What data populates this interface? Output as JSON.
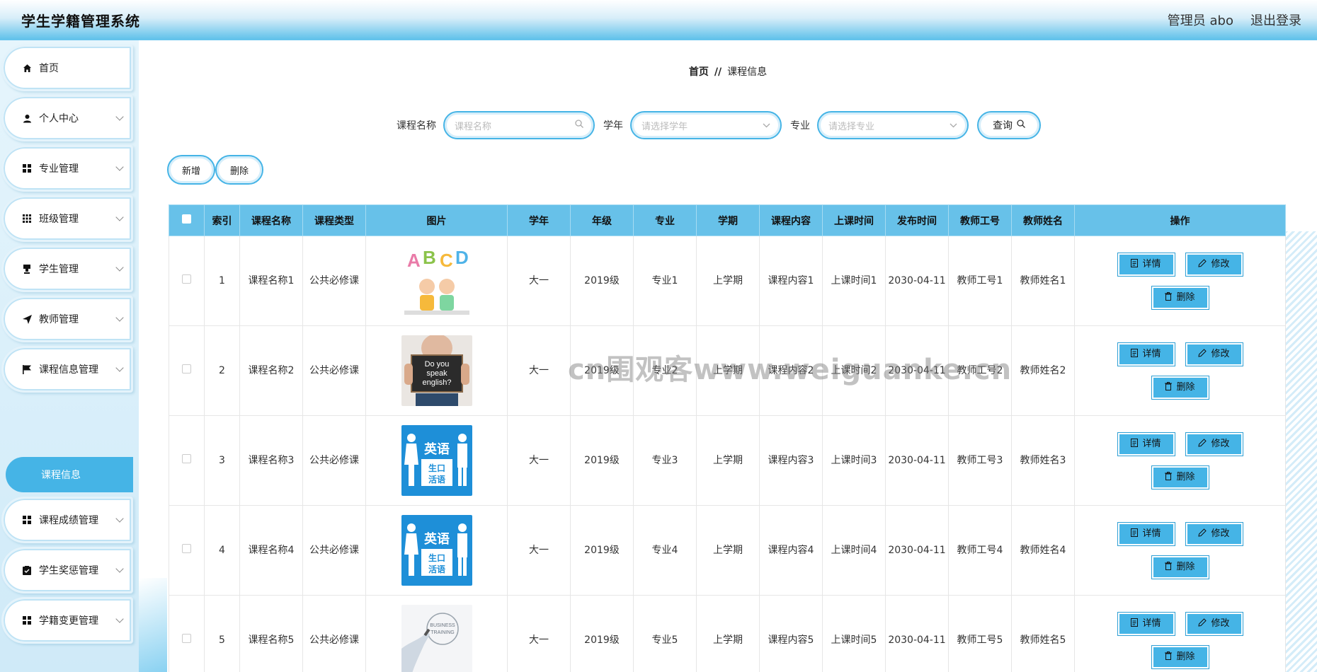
{
  "header": {
    "title": "学生学籍管理系统",
    "user": "管理员 abo",
    "logout": "退出登录"
  },
  "sidebar": {
    "items": [
      {
        "label": "首页",
        "icon": "home-icon"
      },
      {
        "label": "个人中心",
        "icon": "user-icon"
      },
      {
        "label": "专业管理",
        "icon": "grid-icon"
      },
      {
        "label": "班级管理",
        "icon": "grid-dots-icon"
      },
      {
        "label": "学生管理",
        "icon": "stamp-icon"
      },
      {
        "label": "教师管理",
        "icon": "send-icon"
      },
      {
        "label": "课程信息管理",
        "icon": "flag-icon"
      },
      {
        "label": "课程成绩管理",
        "icon": "grid-icon"
      },
      {
        "label": "学生奖惩管理",
        "icon": "clipboard-icon"
      },
      {
        "label": "学籍变更管理",
        "icon": "grid-icon"
      }
    ],
    "active_sub": "课程信息"
  },
  "breadcrumb": {
    "home": "首页",
    "sep": "//",
    "current": "课程信息"
  },
  "search": {
    "course_label": "课程名称",
    "course_placeholder": "课程名称",
    "year_label": "学年",
    "year_placeholder": "请选择学年",
    "major_label": "专业",
    "major_placeholder": "请选择专业",
    "query_label": "查询"
  },
  "actions": {
    "add": "新增",
    "delete": "删除"
  },
  "table": {
    "headers": [
      "",
      "索引",
      "课程名称",
      "课程类型",
      "图片",
      "学年",
      "年级",
      "专业",
      "学期",
      "课程内容",
      "上课时间",
      "发布时间",
      "教师工号",
      "教师姓名",
      "操作"
    ],
    "rows": [
      {
        "index": "1",
        "name": "课程名称1",
        "type": "公共必修课",
        "image": "abcd",
        "year": "大一",
        "grade": "2019级",
        "major": "专业1",
        "term": "上学期",
        "content": "课程内容1",
        "time": "上课时间1",
        "publish": "2030-04-11",
        "tno": "教师工号1",
        "tname": "教师姓名1"
      },
      {
        "index": "2",
        "name": "课程名称2",
        "type": "公共必修课",
        "image": "speak",
        "year": "大一",
        "grade": "2019级",
        "major": "专业2",
        "term": "上学期",
        "content": "课程内容2",
        "time": "上课时间2",
        "publish": "2030-04-11",
        "tno": "教师工号2",
        "tname": "教师姓名2"
      },
      {
        "index": "3",
        "name": "课程名称3",
        "type": "公共必修课",
        "image": "english",
        "year": "大一",
        "grade": "2019级",
        "major": "专业3",
        "term": "上学期",
        "content": "课程内容3",
        "time": "上课时间3",
        "publish": "2030-04-11",
        "tno": "教师工号3",
        "tname": "教师姓名3"
      },
      {
        "index": "4",
        "name": "课程名称4",
        "type": "公共必修课",
        "image": "english",
        "year": "大一",
        "grade": "2019级",
        "major": "专业4",
        "term": "上学期",
        "content": "课程内容4",
        "time": "上课时间4",
        "publish": "2030-04-11",
        "tno": "教师工号4",
        "tname": "教师姓名4"
      },
      {
        "index": "5",
        "name": "课程名称5",
        "type": "公共必修课",
        "image": "business",
        "year": "大一",
        "grade": "2019级",
        "major": "专业5",
        "term": "上学期",
        "content": "课程内容5",
        "time": "上课时间5",
        "publish": "2030-04-11",
        "tno": "教师工号5",
        "tname": "教师姓名5"
      }
    ],
    "ops": {
      "detail": "详情",
      "edit": "修改",
      "delete": "删除"
    }
  },
  "images": {
    "english_top": "英语",
    "english_bottom": "生口活语",
    "speak": "Do you speak english?",
    "business": "BUSINESS TRAINING"
  },
  "watermark": "cn围观客www.weiguanke.cn",
  "colors": {
    "accent": "#45b4e6",
    "header_bg": "#67c1e9"
  }
}
